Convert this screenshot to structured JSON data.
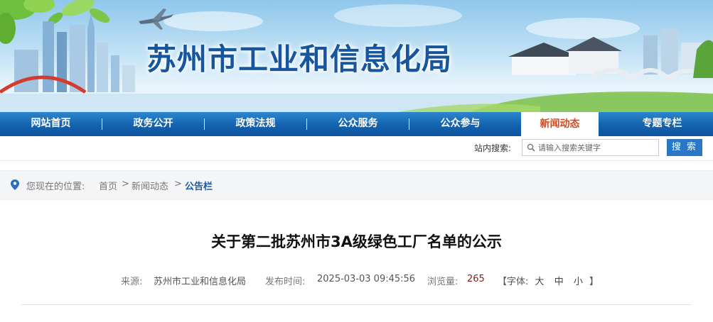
{
  "site": {
    "title": "苏州市工业和信息化局"
  },
  "nav": {
    "items": [
      {
        "label": "网站首页"
      },
      {
        "label": "政务公开"
      },
      {
        "label": "政策法规"
      },
      {
        "label": "公众服务"
      },
      {
        "label": "公众参与"
      },
      {
        "label": "新闻动态",
        "active": true
      },
      {
        "label": "专题专栏"
      }
    ],
    "active_color": "#d5481f"
  },
  "search": {
    "label": "站内搜索:",
    "placeholder": "请输入搜索关键字",
    "button_label": "搜 索"
  },
  "breadcrumb": {
    "prefix": "您现在的位置:",
    "home": "首页",
    "sep1": ">",
    "section": "新闻动态",
    "sep2": ">",
    "current": "公告栏"
  },
  "article": {
    "title": "关于第二批苏州市3A级绿色工厂名单的公示",
    "source_label": "来源:",
    "source": "苏州市工业和信息化局",
    "published_label": "发布时间:",
    "published": "2025-03-03 09:45:56",
    "views_label": "浏览量:",
    "views": "265",
    "font_open": "【字体:",
    "font_large": "大",
    "font_medium": "中",
    "font_small": "小",
    "font_close": "】"
  },
  "colors": {
    "brand_blue": "#17569f",
    "nav_blue": "#1462ad",
    "button_blue": "#2a77c8"
  },
  "icons": {
    "search": "search-icon",
    "location": "location-pin-icon"
  }
}
